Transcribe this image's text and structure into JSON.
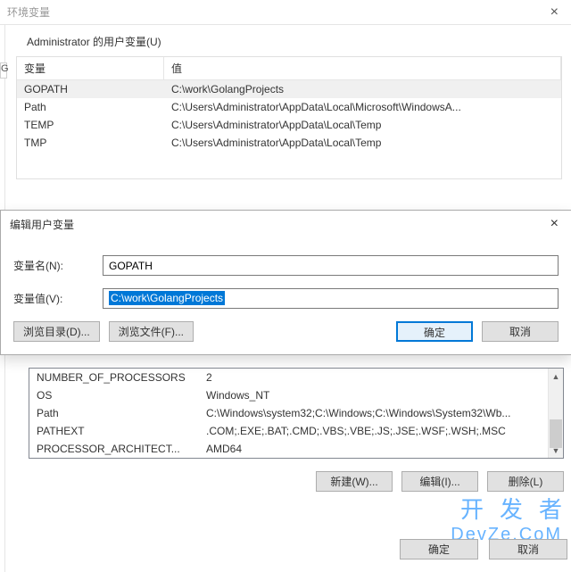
{
  "window": {
    "title": "环境变量",
    "close": "×"
  },
  "userVars": {
    "regionLabel": "Administrator 的用户变量(U)",
    "columns": {
      "name": "变量",
      "value": "值"
    },
    "rows": [
      {
        "name": "GOPATH",
        "value": "C:\\work\\GolangProjects"
      },
      {
        "name": "Path",
        "value": "C:\\Users\\Administrator\\AppData\\Local\\Microsoft\\WindowsA..."
      },
      {
        "name": "TEMP",
        "value": "C:\\Users\\Administrator\\AppData\\Local\\Temp"
      },
      {
        "name": "TMP",
        "value": "C:\\Users\\Administrator\\AppData\\Local\\Temp"
      }
    ]
  },
  "editDlg": {
    "title": "编辑用户变量",
    "close": "×",
    "nameLabel": "变量名(N):",
    "nameValue": "GOPATH",
    "valueLabel": "变量值(V):",
    "valueValue": "C:\\work\\GolangProjects",
    "browseDir": "浏览目录(D)...",
    "browseFile": "浏览文件(F)...",
    "ok": "确定",
    "cancel": "取消"
  },
  "sysVars": {
    "rows": [
      {
        "name": "NUMBER_OF_PROCESSORS",
        "value": "2"
      },
      {
        "name": "OS",
        "value": "Windows_NT"
      },
      {
        "name": "Path",
        "value": "C:\\Windows\\system32;C:\\Windows;C:\\Windows\\System32\\Wb..."
      },
      {
        "name": "PATHEXT",
        "value": ".COM;.EXE;.BAT;.CMD;.VBS;.VBE;.JS;.JSE;.WSF;.WSH;.MSC"
      },
      {
        "name": "PROCESSOR_ARCHITECT...",
        "value": "AMD64"
      }
    ],
    "actions": {
      "new": "新建(W)...",
      "edit": "编辑(I)...",
      "delete": "删除(L)"
    }
  },
  "bottom": {
    "ok": "确定",
    "cancel": "取消"
  },
  "brand": {
    "cn": "开发者",
    "en": "DevZe.CoM"
  },
  "stub": {
    "g": "G"
  }
}
